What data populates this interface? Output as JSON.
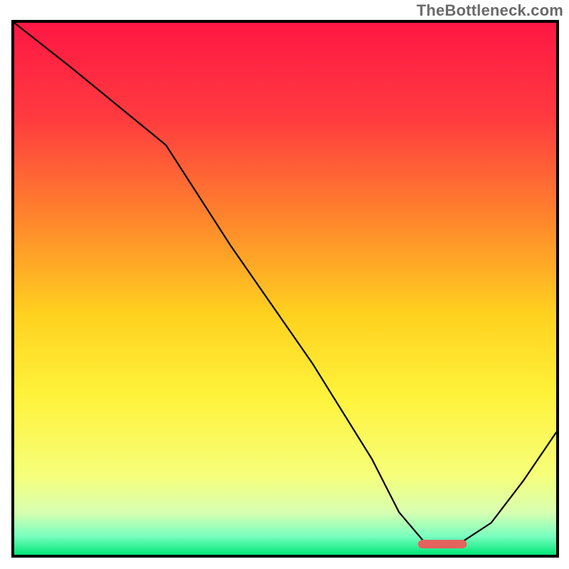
{
  "watermark": "TheBottleneck.com",
  "chart_data": {
    "type": "line",
    "title": "",
    "xlabel": "",
    "ylabel": "",
    "xlim": [
      0,
      100
    ],
    "ylim": [
      0,
      100
    ],
    "grid": false,
    "legend": false,
    "background_gradient": {
      "orientation": "vertical",
      "stops": [
        {
          "offset": 0.0,
          "color": "#ff1744"
        },
        {
          "offset": 0.18,
          "color": "#ff3b3f"
        },
        {
          "offset": 0.38,
          "color": "#ff8a2b"
        },
        {
          "offset": 0.55,
          "color": "#ffd21f"
        },
        {
          "offset": 0.7,
          "color": "#fff23a"
        },
        {
          "offset": 0.85,
          "color": "#f6ff7a"
        },
        {
          "offset": 0.92,
          "color": "#d8ffb0"
        },
        {
          "offset": 0.965,
          "color": "#7affc0"
        },
        {
          "offset": 1.0,
          "color": "#00e676"
        }
      ]
    },
    "series": [
      {
        "name": "bottleneck-curve",
        "color": "#000000",
        "stroke_width": 2.2,
        "x": [
          0,
          10,
          22,
          28,
          40,
          55,
          66,
          71,
          76,
          82,
          88,
          94,
          100
        ],
        "y": [
          100,
          92,
          82,
          77,
          58,
          36,
          18,
          8,
          2,
          2,
          6,
          14,
          23
        ]
      }
    ],
    "markers": [
      {
        "name": "optimum-marker",
        "shape": "rounded-bar",
        "color": "#e4635f",
        "x": 79,
        "y": 2,
        "width_pct": 9,
        "height_pct": 1.6
      }
    ]
  }
}
